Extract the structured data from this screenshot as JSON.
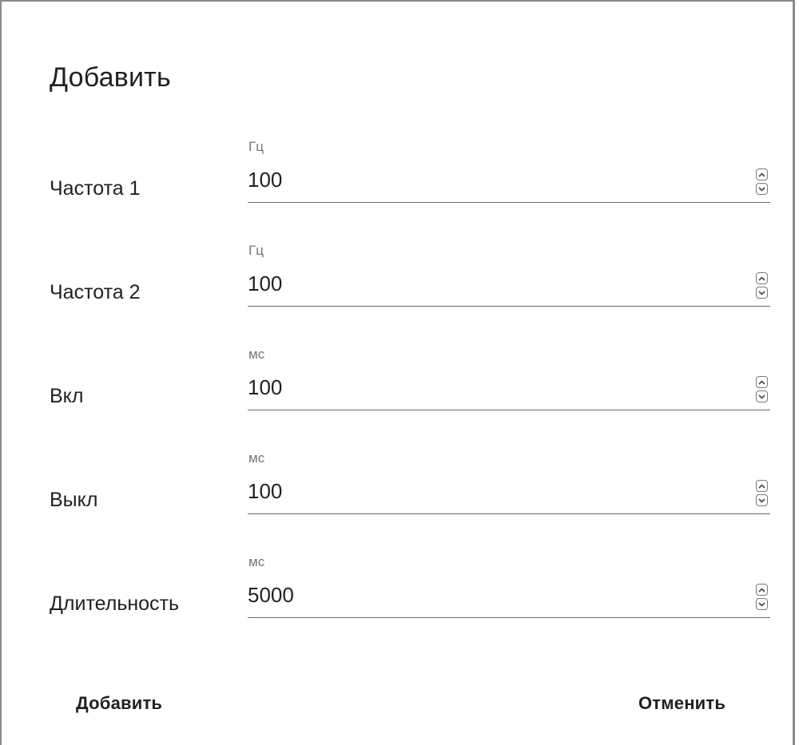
{
  "dialog": {
    "title": "Добавить"
  },
  "fields": [
    {
      "label": "Частота 1",
      "unit": "Гц",
      "value": "100"
    },
    {
      "label": "Частота 2",
      "unit": "Гц",
      "value": "100"
    },
    {
      "label": "Вкл",
      "unit": "мс",
      "value": "100"
    },
    {
      "label": "Выкл",
      "unit": "мс",
      "value": "100"
    },
    {
      "label": "Длительность",
      "unit": "мс",
      "value": "5000"
    }
  ],
  "actions": {
    "add_label": "Добавить",
    "cancel_label": "Отменить"
  },
  "icons": {
    "increment": "chevron-up-icon",
    "decrement": "chevron-down-icon"
  }
}
